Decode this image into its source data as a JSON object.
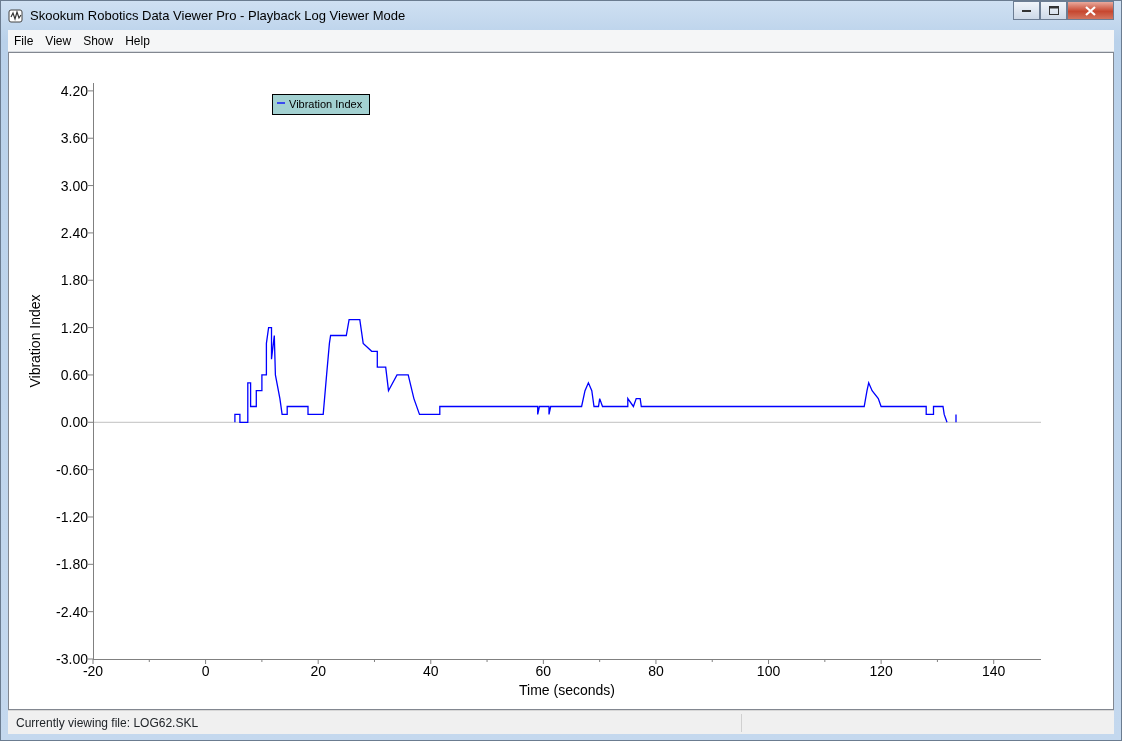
{
  "window": {
    "title": "Skookum Robotics Data Viewer Pro - Playback Log Viewer Mode"
  },
  "menu": [
    "File",
    "View",
    "Show",
    "Help"
  ],
  "chart": {
    "chart_data": {
      "type": "line",
      "xlabel": "Time (seconds)",
      "ylabel": "Vibration Index",
      "xlim": [
        -20,
        148.4
      ],
      "ylim": [
        -3,
        4.3
      ],
      "xticks": [
        -20,
        0,
        20,
        40,
        60,
        80,
        100,
        120,
        140
      ],
      "yticks": [
        {
          "value": 4.2,
          "label": "4.20"
        },
        {
          "value": 3.6,
          "label": "3.60"
        },
        {
          "value": 3.0,
          "label": "3.00"
        },
        {
          "value": 2.4,
          "label": "2.40"
        },
        {
          "value": 1.8,
          "label": "1.80"
        },
        {
          "value": 1.2,
          "label": "1.20"
        },
        {
          "value": 0.6,
          "label": "0.60"
        },
        {
          "value": 0,
          "label": "0.00"
        },
        {
          "value": -0.6,
          "label": "-0.60"
        },
        {
          "value": -1.2,
          "label": "-1.20"
        },
        {
          "value": -1.8,
          "label": "-1.80"
        },
        {
          "value": -2.4,
          "label": "-2.40"
        },
        {
          "value": -3.0,
          "label": "-3.00"
        }
      ],
      "x": [
        5.2,
        5.2,
        6.1,
        6.1,
        7.5,
        7.5,
        8,
        8,
        9,
        9,
        10,
        10,
        10.8,
        10.8,
        11.2,
        11.7,
        11.7,
        12.2,
        12.4,
        13.2,
        13.6,
        14.5,
        14.5,
        18.2,
        18.2,
        20.9,
        21.5,
        22,
        22.2,
        25,
        25.5,
        27.4,
        28,
        29.5,
        30.5,
        30.5,
        32,
        32.5,
        34,
        36,
        37,
        38,
        41.6,
        41.6,
        59,
        59,
        59.3,
        61,
        61,
        61.3,
        66.8,
        67.4,
        68,
        68.6,
        69,
        69.8,
        70,
        70.5,
        75,
        75,
        76,
        76.5,
        77.2,
        77.4,
        117,
        117.5,
        117.8,
        118.4,
        119.5,
        120,
        128,
        128,
        129.3,
        129.3,
        131,
        131.2,
        131.7,
        132.5,
        133.3,
        133.3
      ],
      "series": [
        {
          "name": "Vibration Index",
          "color": "#0000ff",
          "values": [
            0,
            0.1,
            0.1,
            0,
            0,
            0.5,
            0.5,
            0.2,
            0.2,
            0.4,
            0.4,
            0.6,
            0.6,
            1.0,
            1.2,
            1.2,
            0.8,
            1.1,
            0.6,
            0.3,
            0.1,
            0.1,
            0.2,
            0.2,
            0.1,
            0.1,
            0.6,
            1.0,
            1.1,
            1.1,
            1.3,
            1.3,
            1.0,
            0.9,
            0.9,
            0.7,
            0.7,
            0.4,
            0.6,
            0.6,
            0.3,
            0.1,
            0.1,
            0.2,
            0.2,
            0.1,
            0.2,
            0.2,
            0.1,
            0.2,
            0.2,
            0.4,
            0.5,
            0.4,
            0.2,
            0.2,
            0.3,
            0.2,
            0.2,
            0.3,
            0.2,
            0.3,
            0.3,
            0.2,
            0.2,
            0.4,
            0.5,
            0.4,
            0.3,
            0.2,
            0.2,
            0.1,
            0.1,
            0.2,
            0.2,
            0.1,
            0,
            null,
            0,
            0.1
          ]
        }
      ]
    }
  },
  "status_bar": {
    "text": "Currently viewing file: LOG62.SKL"
  }
}
